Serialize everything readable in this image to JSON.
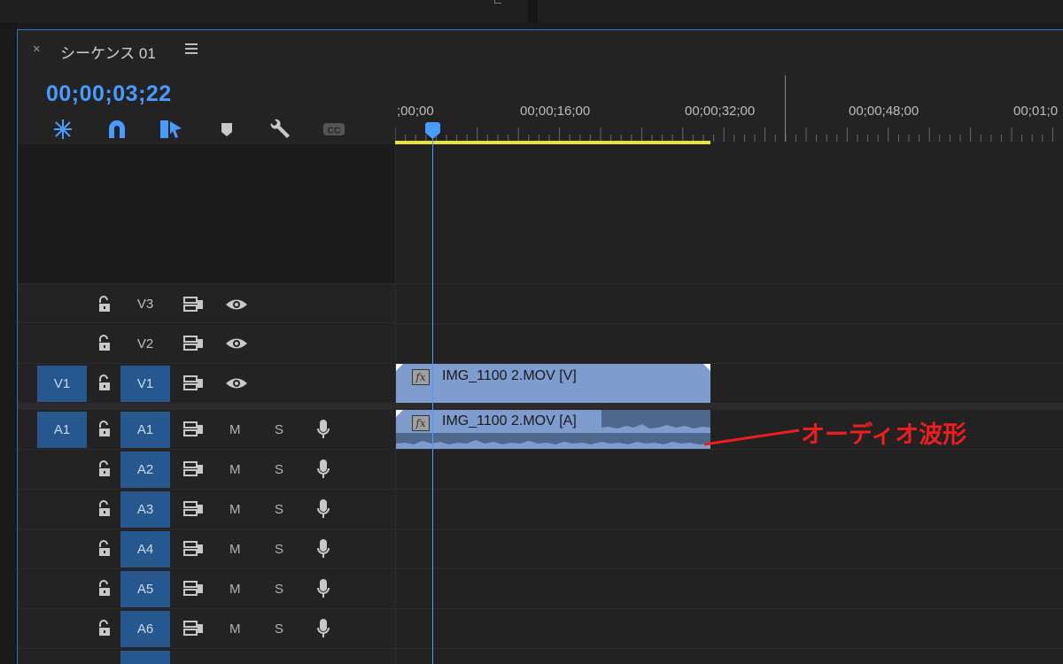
{
  "sequence_tab": {
    "close_symbol": "×",
    "title": "シーケンス 01"
  },
  "timecode": "00;00;03;22",
  "toolbar": {
    "icons": [
      "insert-nest-icon",
      "snap-magnet-icon",
      "linked-selection-icon",
      "add-marker-icon",
      "settings-wrench-icon",
      "captions-cc-icon"
    ],
    "cc_label": "CC"
  },
  "ruler_labels": [
    ";00;00",
    "00;00;16;00",
    "00;00;32;00",
    "00;00;48;00",
    "00;01;0"
  ],
  "video_tracks": [
    {
      "target": "V3",
      "source": "",
      "target_on": false
    },
    {
      "target": "V2",
      "source": "",
      "target_on": false
    },
    {
      "target": "V1",
      "source": "V1",
      "target_on": true
    }
  ],
  "audio_tracks": [
    {
      "target": "A1",
      "source": "A1",
      "m": "M",
      "s": "S"
    },
    {
      "target": "A2",
      "source": "",
      "m": "M",
      "s": "S"
    },
    {
      "target": "A3",
      "source": "",
      "m": "M",
      "s": "S"
    },
    {
      "target": "A4",
      "source": "",
      "m": "M",
      "s": "S"
    },
    {
      "target": "A5",
      "source": "",
      "m": "M",
      "s": "S"
    },
    {
      "target": "A6",
      "source": "",
      "m": "M",
      "s": "S"
    }
  ],
  "clips": {
    "video": {
      "fx": "fx",
      "name": "IMG_1100 2.MOV [V]"
    },
    "audio": {
      "fx": "fx",
      "name": "IMG_1100 2.MOV [A]"
    }
  },
  "annotation": "オーディオ波形",
  "colors": {
    "accent": "#4a9bff",
    "target_blue": "#27578f",
    "clip_blue": "#7f9ccf",
    "inout_yellow": "#e4e43a",
    "annotation_red": "#ef1d1d"
  }
}
